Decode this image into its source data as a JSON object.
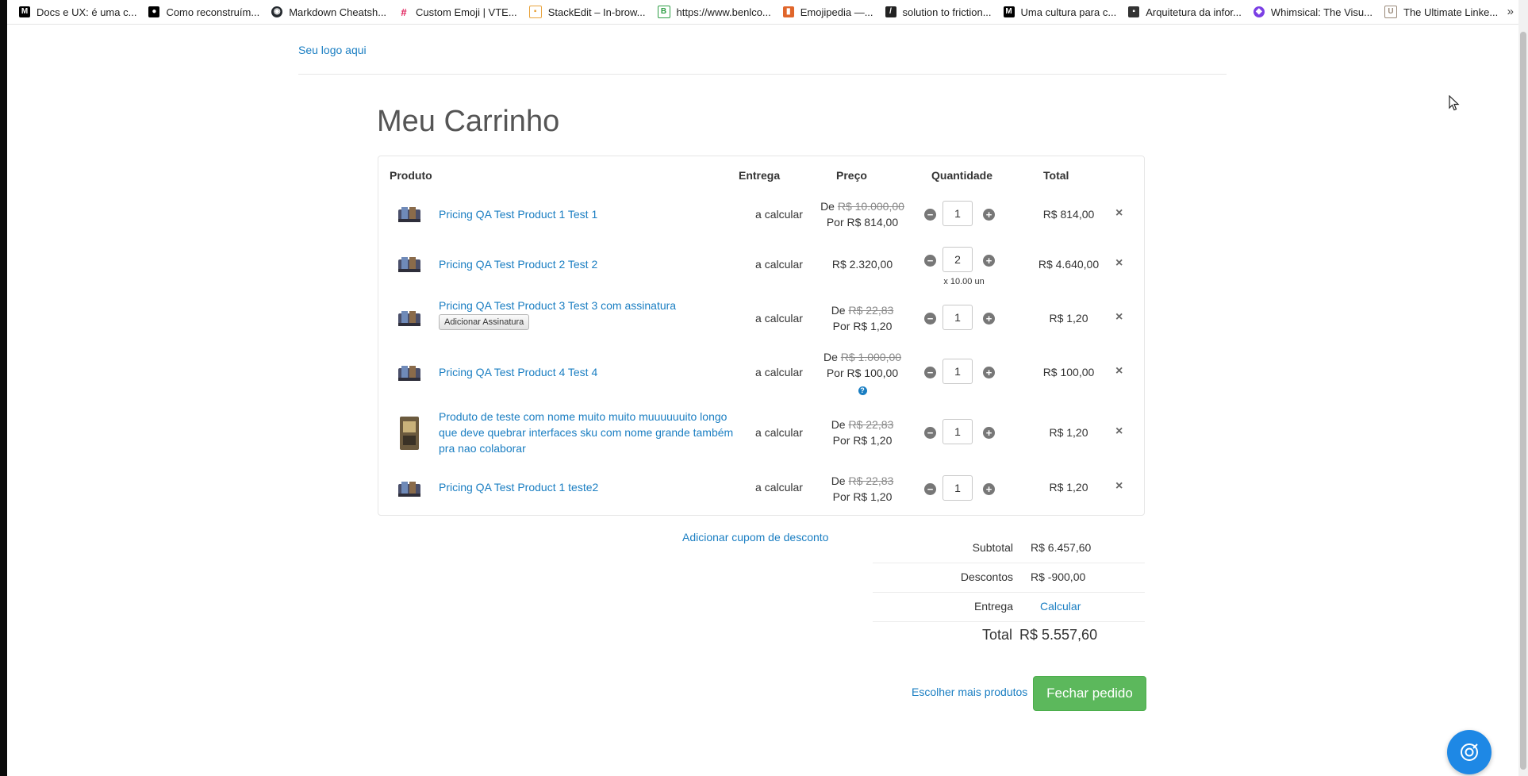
{
  "bookmarks": [
    {
      "label": "Docs e UX: é uma c...",
      "icon": "medium-icon",
      "color": "#000000"
    },
    {
      "label": "Como reconstruím...",
      "icon": "medium-icon",
      "color": "#000000"
    },
    {
      "label": "Markdown Cheatsh...",
      "icon": "github-icon",
      "color": "#24292e"
    },
    {
      "label": "Custom Emoji | VTE...",
      "icon": "slack-icon",
      "color": "#e01e5a"
    },
    {
      "label": "StackEdit – In-brow...",
      "icon": "stackedit-icon",
      "color": "#e8a33c"
    },
    {
      "label": "https://www.benlco...",
      "icon": "link-icon",
      "color": "#2e9e45"
    },
    {
      "label": "Emojipedia —...",
      "icon": "emojipedia-icon",
      "color": "#e0662b"
    },
    {
      "label": "solution to friction...",
      "icon": "stripe-icon",
      "color": "#222222"
    },
    {
      "label": "Uma cultura para c...",
      "icon": "medium-icon",
      "color": "#000000"
    },
    {
      "label": "Arquitetura da infor...",
      "icon": "bookmark-icon",
      "color": "#333333"
    },
    {
      "label": "Whimsical: The Visu...",
      "icon": "whimsical-icon",
      "color": "#7b3fe4"
    },
    {
      "label": "The Ultimate Linke...",
      "icon": "page-icon",
      "color": "#9a8a7a"
    }
  ],
  "header": {
    "logo": "Seu logo aqui",
    "title": "Meu Carrinho"
  },
  "table": {
    "columns": {
      "product": "Produto",
      "delivery": "Entrega",
      "price": "Preço",
      "quantity": "Quantidade",
      "total": "Total"
    },
    "rows": [
      {
        "name": "Pricing QA Test Product 1 Test 1",
        "delivery": "a calcular",
        "price_from": "R$ 10.000,00",
        "price_to": "Por R$ 814,00",
        "qty": "1",
        "total": "R$ 814,00"
      },
      {
        "name": "Pricing QA Test Product 2 Test 2",
        "delivery": "a calcular",
        "price": "R$ 2.320,00",
        "qty": "2",
        "unit": "x 10.00 un",
        "total": "R$ 4.640,00"
      },
      {
        "name": "Pricing QA Test Product 3 Test 3 com assinatura",
        "subscription_button": "Adicionar Assinatura",
        "delivery": "a calcular",
        "price_from": "R$ 22,83",
        "price_to": "Por R$ 1,20",
        "qty": "1",
        "total": "R$ 1,20"
      },
      {
        "name": "Pricing QA Test Product 4 Test 4",
        "delivery": "a calcular",
        "price_from": "R$ 1.000,00",
        "price_to": "Por R$ 100,00",
        "qty": "1",
        "total": "R$ 100,00"
      },
      {
        "name_lines": [
          "Produto de teste com nome muito muito muuuuuuito longo",
          "que deve quebrar interfaces sku com nome grande também",
          "pra nao colaborar"
        ],
        "delivery": "a calcular",
        "price_from": "R$ 22,83",
        "price_to": "Por R$ 1,20",
        "qty": "1",
        "total": "R$ 1,20"
      },
      {
        "name": "Pricing QA Test Product 1 teste2",
        "delivery": "a calcular",
        "price_from": "R$ 22,83",
        "price_to": "Por R$ 1,20",
        "qty": "1",
        "total": "R$ 1,20"
      }
    ],
    "price_from_prefix": "De",
    "remove_icon": "×"
  },
  "summary": {
    "coupon_link": "Adicionar cupom de desconto",
    "subtotal_label": "Subtotal",
    "subtotal_value": "R$ 6.457,60",
    "discount_label": "Descontos",
    "discount_value": "R$ -900,00",
    "delivery_label": "Entrega",
    "delivery_value": "Calcular",
    "total_label": "Total",
    "total_value": "R$ 5.557,60"
  },
  "actions": {
    "more_products": "Escolher mais produtos",
    "checkout": "Fechar pedido"
  },
  "colors": {
    "link": "#1a7ec2",
    "checkout": "#5cb85c",
    "fab": "#1e88e5"
  }
}
